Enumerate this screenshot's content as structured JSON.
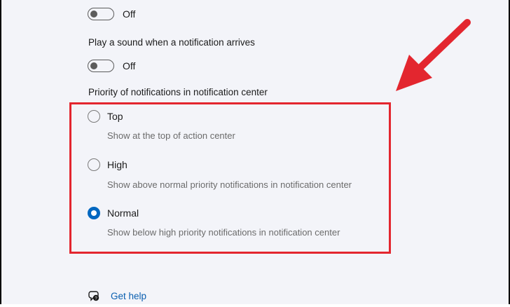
{
  "toggles": [
    {
      "state_label": "Off",
      "on": false
    },
    {
      "state_label": "Off",
      "on": false
    }
  ],
  "sound_setting_label": "Play a sound when a notification arrives",
  "priority_heading": "Priority of notifications in notification center",
  "priority_options": [
    {
      "label": "Top",
      "description": "Show at the top of action center",
      "selected": false
    },
    {
      "label": "High",
      "description": "Show above normal priority notifications in notification center",
      "selected": false
    },
    {
      "label": "Normal",
      "description": "Show below high priority notifications in notification center",
      "selected": true
    }
  ],
  "help": {
    "label": "Get help",
    "icon": "help-chat-icon"
  },
  "colors": {
    "background": "#f3f4f9",
    "accent": "#0067c0",
    "annotation_red": "#e3262f",
    "link": "#0a5fb0"
  }
}
